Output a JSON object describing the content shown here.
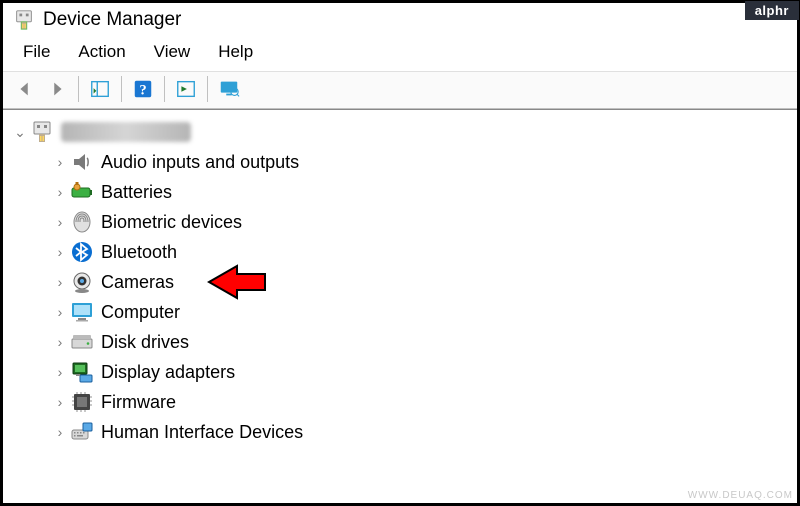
{
  "badge": "alphr",
  "window": {
    "title": "Device Manager"
  },
  "menu": {
    "file": "File",
    "action": "Action",
    "view": "View",
    "help": "Help"
  },
  "root": {
    "label_redacted": true
  },
  "devices": [
    {
      "icon": "audio",
      "label": "Audio inputs and outputs"
    },
    {
      "icon": "battery",
      "label": "Batteries"
    },
    {
      "icon": "biometric",
      "label": "Biometric devices"
    },
    {
      "icon": "bluetooth",
      "label": "Bluetooth"
    },
    {
      "icon": "camera",
      "label": "Cameras"
    },
    {
      "icon": "computer",
      "label": "Computer"
    },
    {
      "icon": "disk",
      "label": "Disk drives"
    },
    {
      "icon": "display",
      "label": "Display adapters"
    },
    {
      "icon": "firmware",
      "label": "Firmware"
    },
    {
      "icon": "hid",
      "label": "Human Interface Devices"
    }
  ],
  "highlight_index": 4,
  "watermark": "WWW.DEUAQ.COM"
}
